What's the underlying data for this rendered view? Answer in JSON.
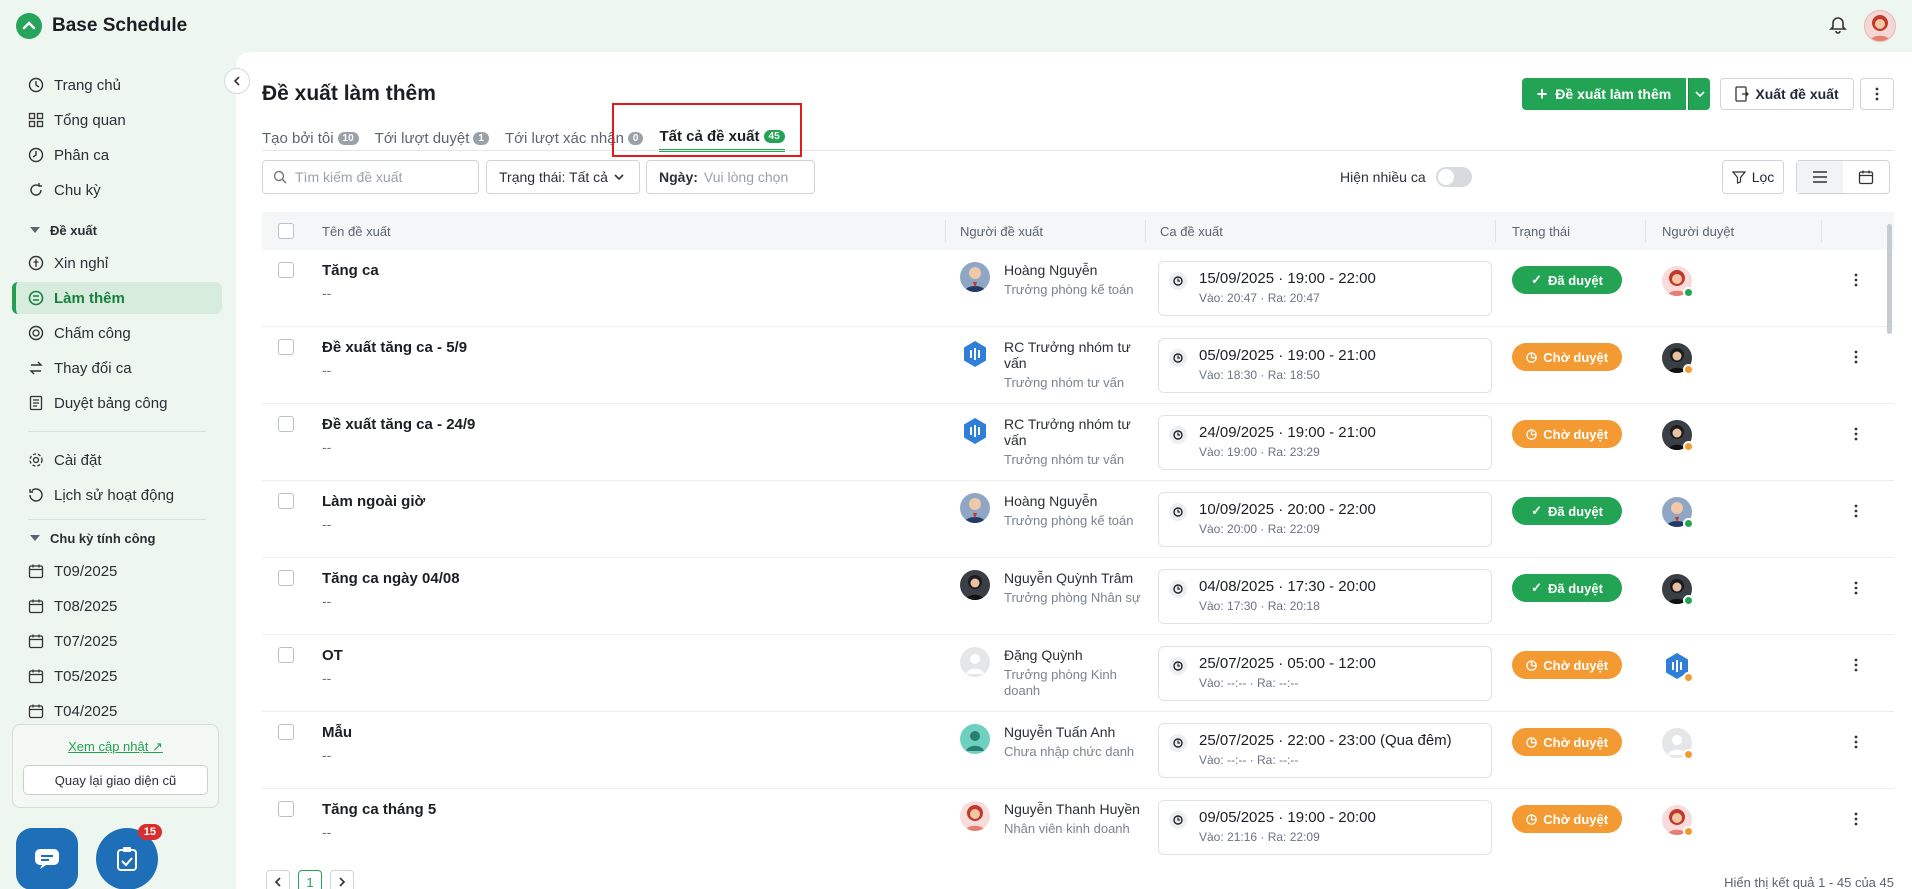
{
  "app": {
    "title": "Base Schedule"
  },
  "sidebar": {
    "items": [
      {
        "label": "Trang chủ",
        "icon": "clock-icon"
      },
      {
        "label": "Tổng quan",
        "icon": "grid-icon"
      },
      {
        "label": "Phân ca",
        "icon": "clock-icon"
      },
      {
        "label": "Chu kỳ",
        "icon": "cycle-icon"
      }
    ],
    "group_proposal": "Đề xuất",
    "proposal_items": [
      {
        "label": "Xin nghỉ",
        "icon": "leave-icon"
      },
      {
        "label": "Làm thêm",
        "icon": "overtime-icon",
        "active": true
      },
      {
        "label": "Chấm công",
        "icon": "timesheet-icon"
      },
      {
        "label": "Thay đổi ca",
        "icon": "swap-icon"
      },
      {
        "label": "Duyệt bảng công",
        "icon": "document-icon"
      }
    ],
    "other_items": [
      {
        "label": "Cài đặt",
        "icon": "gear-icon"
      },
      {
        "label": "Lịch sử hoạt động",
        "icon": "history-icon"
      }
    ],
    "group_cycle": "Chu kỳ tính công",
    "cycles": [
      "T09/2025",
      "T08/2025",
      "T07/2025",
      "T05/2025",
      "T04/2025"
    ],
    "update_link": "Xem cập nhật",
    "old_ui_button": "Quay lại giao diện cũ",
    "task_badge": "15"
  },
  "page": {
    "title": "Đề xuất làm thêm",
    "add_button": "Đề xuất làm thêm",
    "export_button": "Xuất đề xuất",
    "tabs": [
      {
        "label": "Tạo bởi tôi",
        "count": "10"
      },
      {
        "label": "Tới lượt duyệt",
        "count": "1"
      },
      {
        "label": "Tới lượt xác nhận",
        "count": "0"
      },
      {
        "label": "Tất cả đề xuất",
        "count": "45",
        "active": true
      }
    ],
    "search_placeholder": "Tìm kiếm đề xuất",
    "status_filter": "Trạng thái: Tất cả",
    "date_label": "Ngày:",
    "date_placeholder": "Vui lòng chọn",
    "multi_shift": "Hiện nhiều ca",
    "filter_button": "Lọc"
  },
  "table": {
    "headers": [
      "Tên đề xuất",
      "Người đề xuất",
      "Ca đề xuất",
      "Trạng thái",
      "Người duyệt"
    ],
    "rows": [
      {
        "title": "Tăng ca",
        "desc": "--",
        "person": "Hoàng Nguyễn",
        "role": "Trưởng phòng kế toán",
        "avatar": "photo",
        "shift": "15/09/2025 · 19:00 - 22:00",
        "io": "Vào: 20:47 · Ra: 20:47",
        "status": "Đã duyệt",
        "approver": "pink",
        "ok": true
      },
      {
        "title": "Đề xuất tăng ca - 5/9",
        "desc": "--",
        "person": "RC Trưởng nhóm tư vấn",
        "role": "Trưởng nhóm tư vấn",
        "avatar": "hex",
        "shift": "05/09/2025 · 19:00 - 21:00",
        "io": "Vào: 18:30 · Ra: 18:50",
        "status": "Chờ duyệt",
        "approver": "dark",
        "ok": false
      },
      {
        "title": "Đề xuất tăng ca - 24/9",
        "desc": "--",
        "person": "RC Trưởng nhóm tư vấn",
        "role": "Trưởng nhóm tư vấn",
        "avatar": "hex",
        "shift": "24/09/2025 · 19:00 - 21:00",
        "io": "Vào: 19:00 · Ra: 23:29",
        "status": "Chờ duyệt",
        "approver": "dark",
        "ok": false
      },
      {
        "title": "Làm ngoài giờ",
        "desc": "--",
        "person": "Hoàng Nguyễn",
        "role": "Trưởng phòng kế toán",
        "avatar": "photo",
        "shift": "10/09/2025 · 20:00 - 22:00",
        "io": "Vào: 20:00 · Ra: 22:09",
        "status": "Đã duyệt",
        "approver": "photo",
        "ok": true
      },
      {
        "title": "Tăng ca ngày 04/08",
        "desc": "--",
        "person": "Nguyễn Quỳnh Trâm",
        "role": "Trưởng phòng Nhân sự",
        "avatar": "dark",
        "shift": "04/08/2025 · 17:30 - 20:00",
        "io": "Vào: 17:30 · Ra: 20:18",
        "status": "Đã duyệt",
        "approver": "dark",
        "ok": true
      },
      {
        "title": "OT",
        "desc": "--",
        "person": "Đặng Quỳnh",
        "role": "Trưởng phòng Kinh doanh",
        "avatar": "grey",
        "shift": "25/07/2025 · 05:00 - 12:00",
        "io": "Vào: --:-- · Ra: --:--",
        "status": "Chờ duyệt",
        "approver": "hex",
        "ok": false
      },
      {
        "title": "Mẫu",
        "desc": "--",
        "person": "Nguyễn Tuấn Anh",
        "role": "Chưa nhập chức danh",
        "avatar": "teal",
        "shift": "25/07/2025 · 22:00 - 23:00 (Qua đêm)",
        "io": "Vào: --:-- · Ra: --:--",
        "status": "Chờ duyệt",
        "approver": "grey",
        "ok": false
      },
      {
        "title": "Tăng ca tháng 5",
        "desc": "--",
        "person": "Nguyễn Thanh Huyền",
        "role": "Nhân viên kinh doanh",
        "avatar": "pink",
        "shift": "09/05/2025 · 19:00 - 20:00",
        "io": "Vào: 21:16 · Ra: 22:09",
        "status": "Chờ duyệt",
        "approver": "pink",
        "ok": false
      }
    ]
  },
  "pagination": {
    "current": "1",
    "summary": "Hiển thị kết quả 1 - 45 của 45"
  },
  "colors": {
    "accent": "#22a454",
    "pending": "#f49a32",
    "highlight": "#e3191c"
  }
}
